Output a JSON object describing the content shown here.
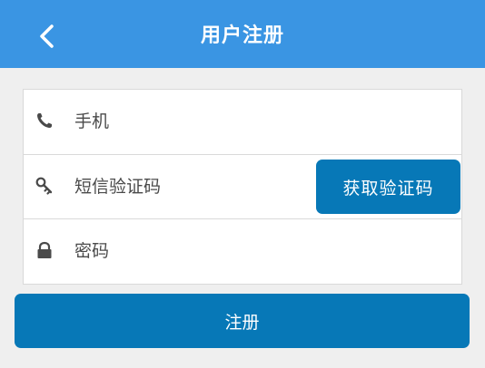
{
  "header": {
    "title": "用户注册",
    "back_icon": "chevron-left-icon",
    "background_color": "#3a95e3"
  },
  "form": {
    "phone": {
      "icon": "phone-icon",
      "placeholder": "手机",
      "value": ""
    },
    "sms_code": {
      "icon": "key-icon",
      "placeholder": "短信验证码",
      "value": "",
      "get_code_label": "获取验证码"
    },
    "password": {
      "icon": "lock-icon",
      "placeholder": "密码",
      "value": ""
    }
  },
  "actions": {
    "register_label": "注册",
    "button_color": "#0778b7"
  }
}
